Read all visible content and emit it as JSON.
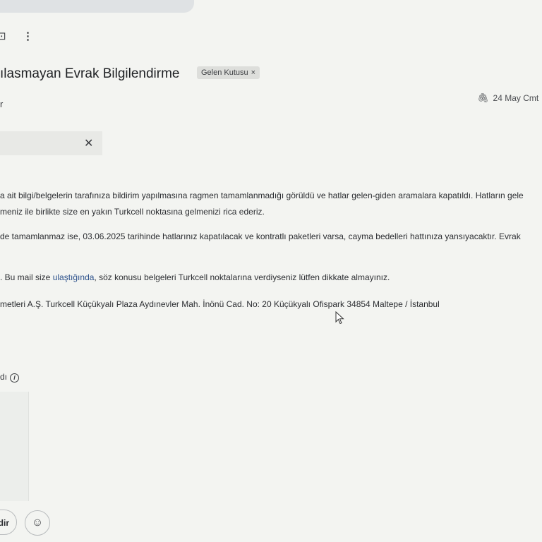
{
  "toolbar": {
    "label_icon": "label-icon",
    "more_icon": "more-vert-icon"
  },
  "email": {
    "subject": "ılasmayan Evrak Bilgilendirme",
    "label_chip": "Gelen Kutusu",
    "sender_fragment": "r",
    "date": "24 May Cmt",
    "attachment_icon": "paperclip-icon"
  },
  "body": {
    "line1": "a ait bilgi/belgelerin tarafınıza bildirim yapılmasına ragmen tamamlanmadığı görüldü ve hatlar gelen-giden aramalara kapatıldı. Hatların gele",
    "line2": "meniz ile birlikte size en yakın Turkcell noktasına gelmenizi rica ederiz.",
    "line3": "de tamamlanmaz ise, 03.06.2025 tarihinde hatlarınız kapatılacak ve kontratlı paketleri varsa, cayma bedelleri hattınıza yansıyacaktır. Evrak",
    "line4_pre": ". Bu mail size ",
    "line4_link": "ulaştığında",
    "line4_post": ", söz konusu belgeleri Turkcell noktalarına verdiyseniz lütfen dikkate almayınız.",
    "line5": "metleri A.Ş. Turkcell Küçükyalı Plaza Aydınevler Mah. İnönü Cad. No: 20 Küçükyalı Ofispark 34854 Maltepe / İstanbul"
  },
  "footer": {
    "fragment": "dı"
  },
  "actions": {
    "forward_fragment": "dir",
    "emoji_icon": "emoji-icon"
  }
}
